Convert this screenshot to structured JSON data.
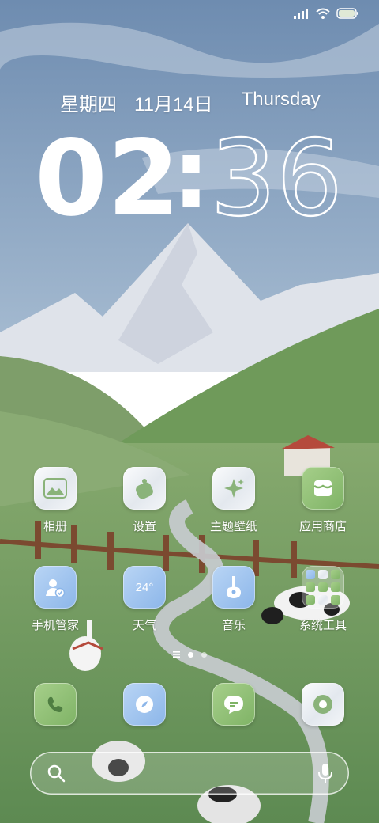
{
  "status_bar": {
    "battery_color": "#dfe8d6"
  },
  "lock_date": {
    "weekday_zh": "星期四",
    "date_zh": "11月14日",
    "weekday_en": "Thursday"
  },
  "clock": {
    "hours": "02",
    "separator": ":",
    "minutes": "36"
  },
  "apps_row1": [
    {
      "label": "相册",
      "icon": "gallery-icon"
    },
    {
      "label": "设置",
      "icon": "settings-icon"
    },
    {
      "label": "主题壁纸",
      "icon": "themes-icon"
    },
    {
      "label": "应用商店",
      "icon": "app-store-icon"
    }
  ],
  "apps_row2": [
    {
      "label": "手机管家",
      "icon": "security-icon"
    },
    {
      "label": "天气",
      "icon": "weather-icon",
      "temp": "24°"
    },
    {
      "label": "音乐",
      "icon": "music-icon"
    },
    {
      "label": "系统工具",
      "icon": "folder-icon"
    }
  ],
  "dock": [
    {
      "icon": "phone-icon"
    },
    {
      "icon": "browser-icon"
    },
    {
      "icon": "messages-icon"
    },
    {
      "icon": "camera-icon"
    }
  ],
  "page_indicator": {
    "pages": 2,
    "active": 1
  },
  "colors": {
    "sky": "#6f8fb4",
    "grass": "#6f9a62",
    "accent_green": "#7fb366",
    "accent_blue": "#8cb6e9"
  }
}
